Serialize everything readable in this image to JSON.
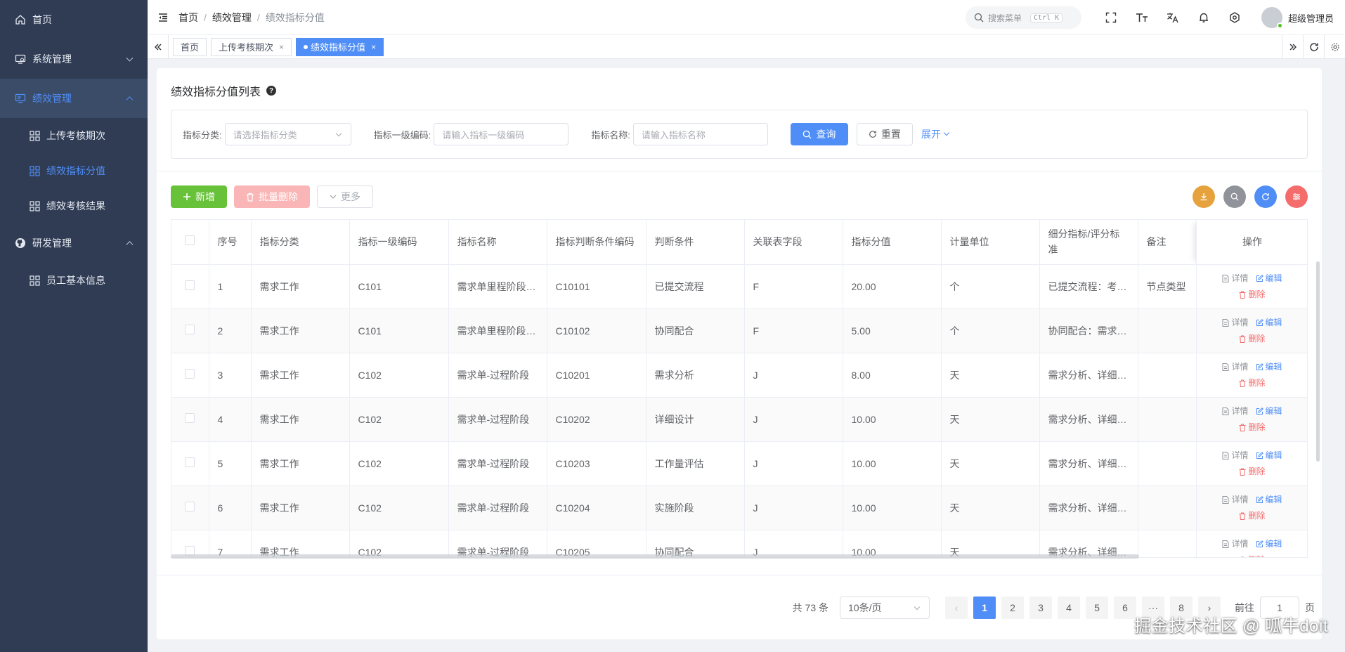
{
  "sidebar": {
    "home": "首页",
    "system": "系统管理",
    "performance": "绩效管理",
    "performance_children": [
      "上传考核期次",
      "绩效指标分值",
      "绩效考核结果"
    ],
    "rd": "研发管理",
    "rd_children": [
      "员工基本信息"
    ]
  },
  "header": {
    "breadcrumb": [
      "首页",
      "绩效管理",
      "绩效指标分值"
    ],
    "breadcrumb_sep": "/",
    "search_placeholder": "搜索菜单",
    "search_shortcut": "Ctrl K",
    "username": "超级管理员"
  },
  "tabs": [
    {
      "label": "首页"
    },
    {
      "label": "上传考核期次",
      "close": "×"
    },
    {
      "label": "绩效指标分值",
      "close": "×"
    }
  ],
  "card": {
    "title": "绩效指标分值列表",
    "help_glyph": "?"
  },
  "filter": {
    "category_label": "指标分类:",
    "category_placeholder": "请选择指标分类",
    "code_label": "指标一级编码:",
    "code_placeholder": "请输入指标一级编码",
    "name_label": "指标名称:",
    "name_placeholder": "请输入指标名称",
    "query": "查询",
    "reset": "重置",
    "expand": "展开"
  },
  "toolbar": {
    "add": "新增",
    "batch_delete": "批量删除",
    "more": "更多"
  },
  "table": {
    "columns": [
      "序号",
      "指标分类",
      "指标一级编码",
      "指标名称",
      "指标判断条件编码",
      "判断条件",
      "关联表字段",
      "指标分值",
      "计量单位",
      "细分指标/评分标准",
      "备注",
      "操作"
    ],
    "ops": {
      "detail": "详情",
      "edit": "编辑",
      "delete": "删除"
    },
    "rows": [
      [
        "1",
        "需求工作",
        "C101",
        "需求单里程阶段…",
        "C10101",
        "已提交流程",
        "F",
        "20.00",
        "个",
        "已提交流程：考…",
        "节点类型"
      ],
      [
        "2",
        "需求工作",
        "C101",
        "需求单里程阶段…",
        "C10102",
        "协同配合",
        "F",
        "5.00",
        "个",
        "协同配合：需求…",
        ""
      ],
      [
        "3",
        "需求工作",
        "C102",
        "需求单-过程阶段",
        "C10201",
        "需求分析",
        "J",
        "8.00",
        "天",
        "需求分析、详细…",
        ""
      ],
      [
        "4",
        "需求工作",
        "C102",
        "需求单-过程阶段",
        "C10202",
        "详细设计",
        "J",
        "10.00",
        "天",
        "需求分析、详细…",
        ""
      ],
      [
        "5",
        "需求工作",
        "C102",
        "需求单-过程阶段",
        "C10203",
        "工作量评估",
        "J",
        "10.00",
        "天",
        "需求分析、详细…",
        ""
      ],
      [
        "6",
        "需求工作",
        "C102",
        "需求单-过程阶段",
        "C10204",
        "实施阶段",
        "J",
        "10.00",
        "天",
        "需求分析、详细…",
        ""
      ],
      [
        "7",
        "需求工作",
        "C102",
        "需求单-过程阶段",
        "C10205",
        "协同配合",
        "J",
        "10.00",
        "天",
        "需求分析、详细…",
        ""
      ]
    ]
  },
  "pagination": {
    "total": "共 73 条",
    "page_size": "10条/页",
    "pages": [
      "1",
      "2",
      "3",
      "4",
      "5",
      "6",
      "···",
      "8"
    ],
    "current": "1",
    "prev": "‹",
    "next": "›",
    "goto_label": "前往",
    "goto_value": "1",
    "goto_suffix": "页"
  },
  "watermark": "掘金技术社区 @ 呱牛doit",
  "colors": {
    "sidebar_bg": "#2f3c54",
    "primary": "#4f8ef7",
    "success": "#67c23a",
    "danger": "#f56c6c",
    "tool_download": "#e6a23c",
    "tool_search": "#909399",
    "tool_refresh": "#4f8ef7",
    "tool_columns": "#f56c6c"
  }
}
